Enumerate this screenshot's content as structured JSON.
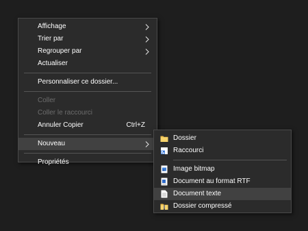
{
  "context_menu": {
    "items": [
      {
        "label": "Affichage",
        "has_submenu": true
      },
      {
        "label": "Trier par",
        "has_submenu": true
      },
      {
        "label": "Regrouper par",
        "has_submenu": true
      },
      {
        "label": "Actualiser"
      },
      {
        "label": "Personnaliser ce dossier..."
      },
      {
        "label": "Coller",
        "disabled": true
      },
      {
        "label": "Coller le raccourci",
        "disabled": true
      },
      {
        "label": "Annuler Copier",
        "shortcut": "Ctrl+Z"
      },
      {
        "label": "Nouveau",
        "has_submenu": true,
        "highlighted": true
      },
      {
        "label": "Propriétés"
      }
    ]
  },
  "submenu": {
    "items": [
      {
        "label": "Dossier",
        "icon": "folder-icon"
      },
      {
        "label": "Raccourci",
        "icon": "shortcut-icon"
      },
      {
        "label": "Image bitmap",
        "icon": "bitmap-image-icon"
      },
      {
        "label": "Document au format RTF",
        "icon": "rtf-document-icon"
      },
      {
        "label": "Document texte",
        "icon": "text-document-icon",
        "highlighted": true
      },
      {
        "label": "Dossier compressé",
        "icon": "zip-folder-icon"
      }
    ]
  },
  "colors": {
    "background": "#1e1e1e",
    "menu_background": "#2b2b2b",
    "highlight": "#414141",
    "disabled_text": "#6d6d6d",
    "separator": "#555555"
  }
}
